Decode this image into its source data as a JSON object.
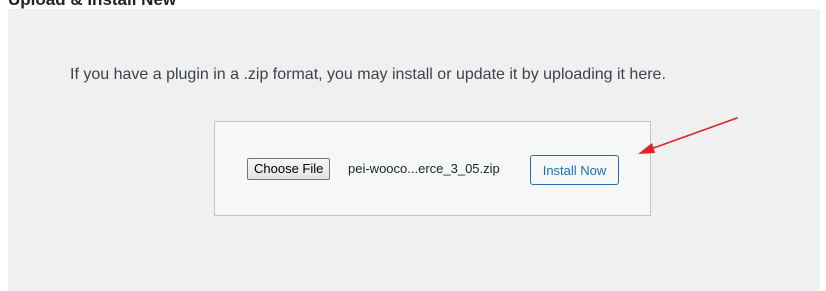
{
  "header": {
    "heading": "Upload & Install New"
  },
  "upload": {
    "intro_text": "If you have a plugin in a .zip format, you may install or update it by uploading it here.",
    "choose_file_label": "Choose File",
    "selected_file": "pei-wooco...erce_3_05.zip",
    "install_label": "Install Now"
  },
  "annotation": {
    "arrow_icon": "red-arrow-icon",
    "arrow_color": "#e02424"
  },
  "colors": {
    "panel_bg": "#f0f0f1",
    "box_bg": "#f6f7f7",
    "accent": "#2271b1"
  }
}
